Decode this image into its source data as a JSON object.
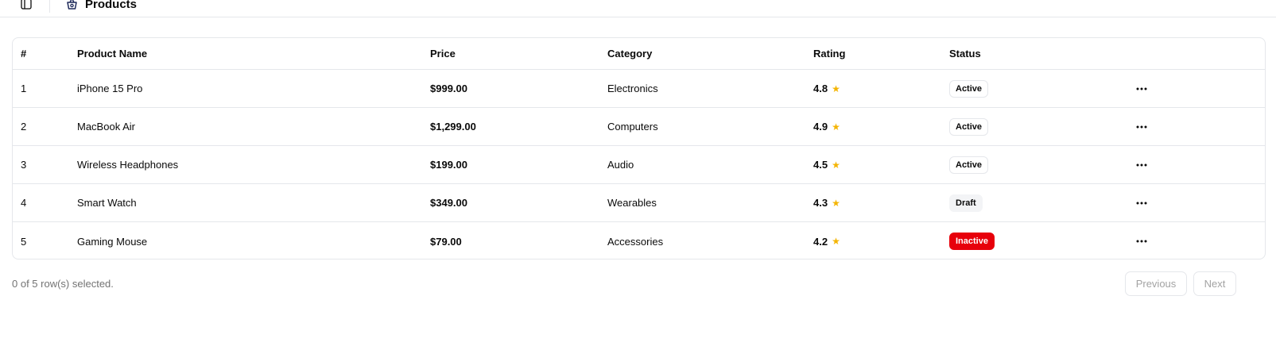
{
  "header": {
    "title": "Products",
    "sidebar_toggle_icon": "panel-left-icon",
    "page_icon": "shopping-basket-icon"
  },
  "table": {
    "columns": {
      "num": "#",
      "name": "Product Name",
      "price": "Price",
      "category": "Category",
      "rating": "Rating",
      "status": "Status"
    },
    "rows": [
      {
        "num": "1",
        "name": "iPhone 15 Pro",
        "price": "$999.00",
        "category": "Electronics",
        "rating": "4.8",
        "star": "★",
        "status": "Active",
        "status_variant": "outline",
        "actions": "···"
      },
      {
        "num": "2",
        "name": "MacBook Air",
        "price": "$1,299.00",
        "category": "Computers",
        "rating": "4.9",
        "star": "★",
        "status": "Active",
        "status_variant": "outline",
        "actions": "···"
      },
      {
        "num": "3",
        "name": "Wireless Headphones",
        "price": "$199.00",
        "category": "Audio",
        "rating": "4.5",
        "star": "★",
        "status": "Active",
        "status_variant": "outline",
        "actions": "···"
      },
      {
        "num": "4",
        "name": "Smart Watch",
        "price": "$349.00",
        "category": "Wearables",
        "rating": "4.3",
        "star": "★",
        "status": "Draft",
        "status_variant": "secondary",
        "actions": "···"
      },
      {
        "num": "5",
        "name": "Gaming Mouse",
        "price": "$79.00",
        "category": "Accessories",
        "rating": "4.2",
        "star": "★",
        "status": "Inactive",
        "status_variant": "destructive",
        "actions": "···"
      }
    ]
  },
  "footer": {
    "selection_text": "0 of 5 row(s) selected.",
    "previous_label": "Previous",
    "next_label": "Next"
  },
  "colors": {
    "star": "#f4b400",
    "destructive": "#e7000b",
    "border": "#e5e7eb",
    "muted_text": "#737373"
  }
}
